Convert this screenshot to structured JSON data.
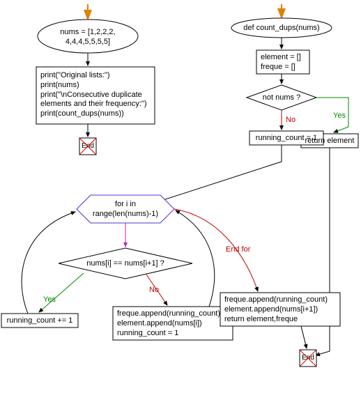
{
  "main_flow": {
    "start_code": "nums = [1,2,2,2,\n4,4,4,5,5,5,5]",
    "print_block": "print(\"Original lists:\")\nprint(nums)\nprint(\"\\nConsecutive duplicate\nelements and their frequency:\")\nprint(count_dups(nums))",
    "end": "End"
  },
  "func_flow": {
    "def": "def count_dups(nums)",
    "init": "element = []\nfreque = []",
    "guard": "not nums ?",
    "guard_yes": "Yes",
    "guard_no": "No",
    "return_empty": "return element",
    "running_init": "running_count = 1",
    "for_header": "for i in\nrange(len(nums)-1)",
    "end_for": "End for",
    "cond": "nums[i] == nums[i+1] ?",
    "cond_yes": "Yes",
    "cond_no": "No",
    "incr": "running_count += 1",
    "else_body": "freque.append(running_count)\nelement.append(nums[i])\nrunning_count = 1",
    "after_loop": "freque.append(running_count)\nelement.append(nums[i+1])\nreturn element,freque",
    "end": "End"
  }
}
